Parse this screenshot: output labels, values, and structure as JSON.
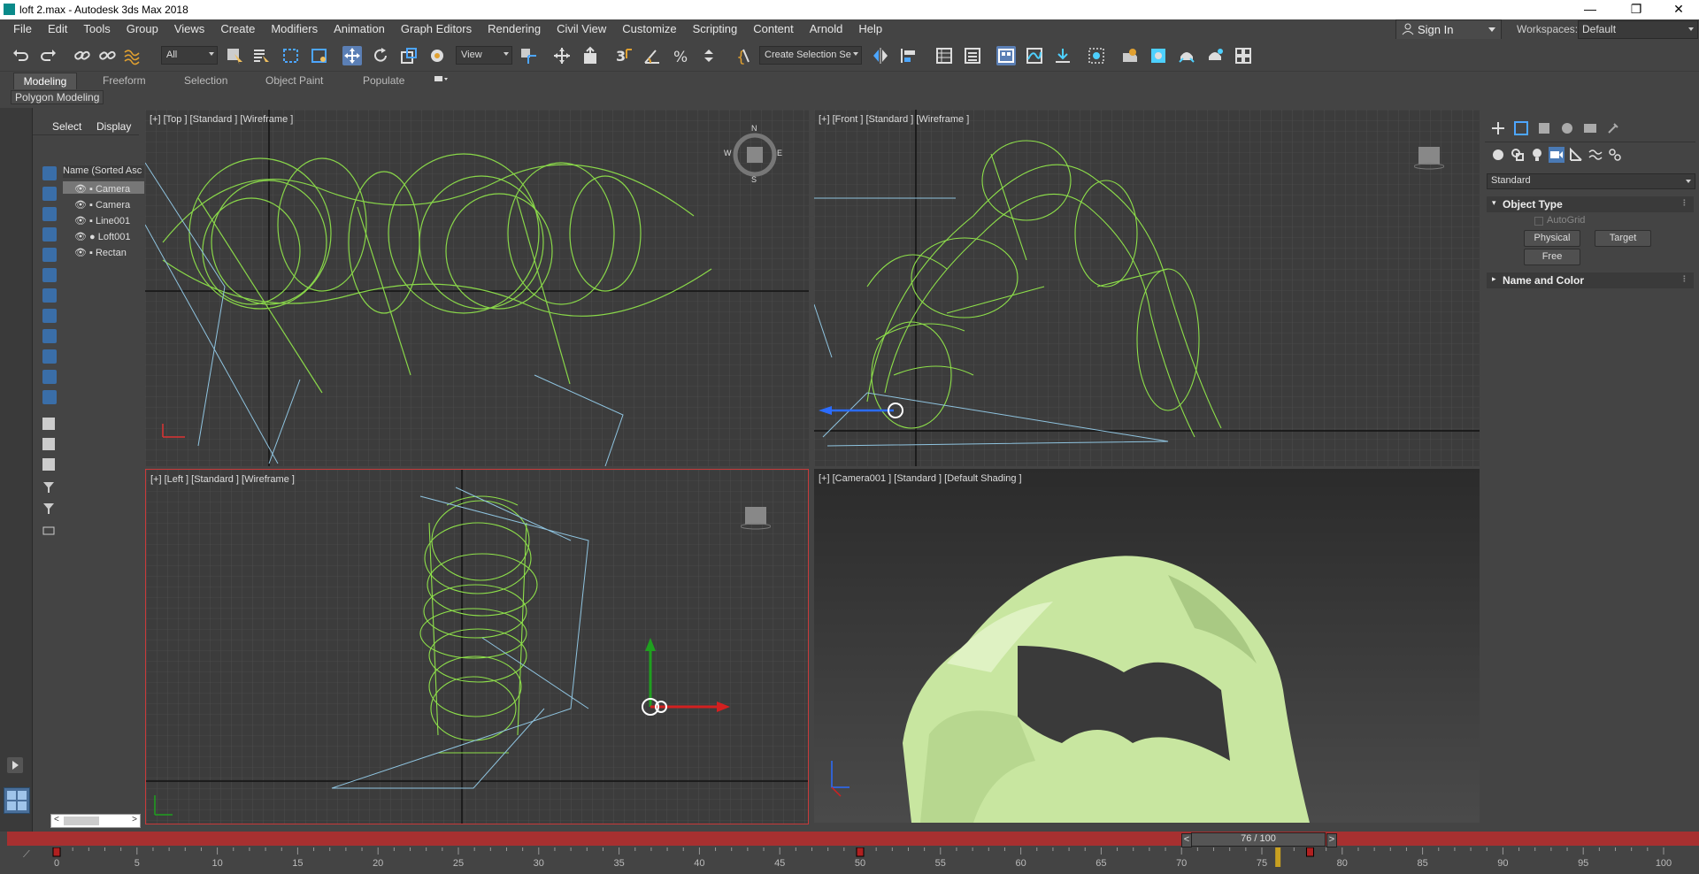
{
  "window": {
    "title": "loft 2.max - Autodesk 3ds Max 2018",
    "controls": [
      "—",
      "❐",
      "✕"
    ]
  },
  "menubar": {
    "items": [
      "File",
      "Edit",
      "Tools",
      "Group",
      "Views",
      "Create",
      "Modifiers",
      "Animation",
      "Graph Editors",
      "Rendering",
      "Civil View",
      "Customize",
      "Scripting",
      "Content",
      "Arnold",
      "Help"
    ],
    "sign_in": "Sign In",
    "workspaces_label": "Workspaces:",
    "workspace_value": "Default"
  },
  "toolbar": {
    "selection_filter": "All",
    "ref_coord": "View",
    "selection_set": "Create Selection Se"
  },
  "ribbon": {
    "tabs": [
      "Modeling",
      "Freeform",
      "Selection",
      "Object Paint",
      "Populate"
    ],
    "active_tab": "Modeling",
    "panel": "Polygon Modeling"
  },
  "scene_explorer": {
    "tabs": [
      "Select",
      "Display"
    ],
    "column_header": "Name (Sorted Asc",
    "rows": [
      "Camera",
      "Camera",
      "Line001",
      "Loft001",
      "Rectan"
    ]
  },
  "viewports": {
    "top": {
      "label": "[+] [Top ] [Standard ] [Wireframe ]",
      "compass": [
        "N",
        "E",
        "S",
        "W"
      ]
    },
    "front": {
      "label": "[+] [Front ] [Standard ] [Wireframe ]"
    },
    "left": {
      "label": "[+] [Left ] [Standard ] [Wireframe ]"
    },
    "camera": {
      "label": "[+] [Camera001 ] [Standard ] [Default Shading ]"
    }
  },
  "command_panel": {
    "category": "Standard",
    "object_type_title": "Object Type",
    "autogrid": "AutoGrid",
    "buttons": [
      "Physical",
      "Target",
      "Free"
    ],
    "name_and_color": "Name and Color"
  },
  "timeline": {
    "frame": "76 / 100",
    "ticks": [
      "0",
      "5",
      "10",
      "15",
      "20",
      "25",
      "30",
      "35",
      "40",
      "45",
      "50",
      "55",
      "60",
      "65",
      "70",
      "75",
      "80",
      "85",
      "90",
      "95",
      "100"
    ]
  },
  "colors": {
    "wire": "#8ee04a",
    "shaded": "#c8e6a0",
    "timebar": "#a73030",
    "accent": "#3a6ea8"
  }
}
